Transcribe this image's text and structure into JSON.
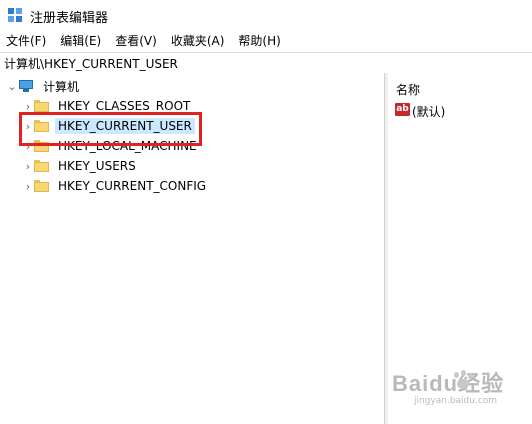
{
  "window": {
    "title": "注册表编辑器"
  },
  "menu": [
    {
      "label": "文件(F)"
    },
    {
      "label": "编辑(E)"
    },
    {
      "label": "查看(V)"
    },
    {
      "label": "收藏夹(A)"
    },
    {
      "label": "帮助(H)"
    }
  ],
  "address": {
    "path": "计算机\\HKEY_CURRENT_USER"
  },
  "tree": {
    "root": {
      "label": "计算机",
      "expanded": true
    },
    "children": [
      {
        "label": "HKEY_CLASSES_ROOT"
      },
      {
        "label": "HKEY_CURRENT_USER",
        "selected": true
      },
      {
        "label": "HKEY_LOCAL_MACHINE"
      },
      {
        "label": "HKEY_USERS"
      },
      {
        "label": "HKEY_CURRENT_CONFIG"
      }
    ]
  },
  "values_pane": {
    "columns": [
      {
        "label": "名称"
      }
    ],
    "rows": [
      {
        "name": "(默认)",
        "icon": "ab",
        "icon_color": "#c62828"
      }
    ]
  },
  "annotation": {
    "color": "#e02222"
  },
  "watermark": {
    "main": "Baidu经验",
    "sub": "jingyan.baidu.com"
  },
  "colors": {
    "selection": "#cce8ff",
    "folder": "#f7d774"
  }
}
